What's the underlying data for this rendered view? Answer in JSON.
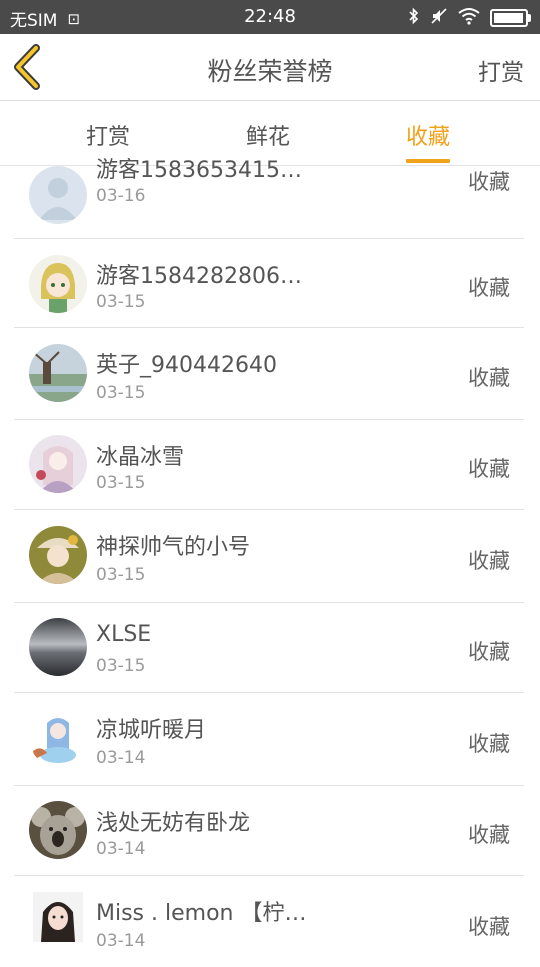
{
  "status_bar": {
    "carrier": "无SIM",
    "time": "22:48",
    "battery_level": 0.95,
    "icons": [
      "sim-card-icon",
      "bluetooth-icon",
      "mute-icon",
      "wifi-icon",
      "battery-icon"
    ]
  },
  "header": {
    "title": "粉丝荣誉榜",
    "right_action": "打赏",
    "back_icon": "chevron-left-icon"
  },
  "tabs": [
    {
      "label": "打赏",
      "active": false
    },
    {
      "label": "鲜花",
      "active": false
    },
    {
      "label": "收藏",
      "active": true
    }
  ],
  "colors": {
    "accent": "#f0a21b",
    "status_bar_bg": "#4a4a4a"
  },
  "list": [
    {
      "name": "游客1583653415…",
      "date": "03-16",
      "action": "收藏",
      "avatar": "default-user-avatar"
    },
    {
      "name": "游客1584282806…",
      "date": "03-15",
      "action": "收藏",
      "avatar": "anime-girl-avatar"
    },
    {
      "name": "英子_940442640",
      "date": "03-15",
      "action": "收藏",
      "avatar": "windmill-avatar"
    },
    {
      "name": "冰晶冰雪",
      "date": "03-15",
      "action": "收藏",
      "avatar": "anime-girl-avatar"
    },
    {
      "name": "神探帅气的小号",
      "date": "03-15",
      "action": "收藏",
      "avatar": "anime-girl-avatar"
    },
    {
      "name": "XLSE",
      "date": "03-15",
      "action": "收藏",
      "avatar": "dark-landscape-avatar"
    },
    {
      "name": "凉城听暖月",
      "date": "03-14",
      "action": "收藏",
      "avatar": "anime-girl-avatar"
    },
    {
      "name": "浅处无妨有卧龙",
      "date": "03-14",
      "action": "收藏",
      "avatar": "koala-avatar"
    },
    {
      "name": "Miss . lemon 【柠…",
      "date": "03-14",
      "action": "收藏",
      "avatar": "girl-photo-avatar"
    }
  ]
}
